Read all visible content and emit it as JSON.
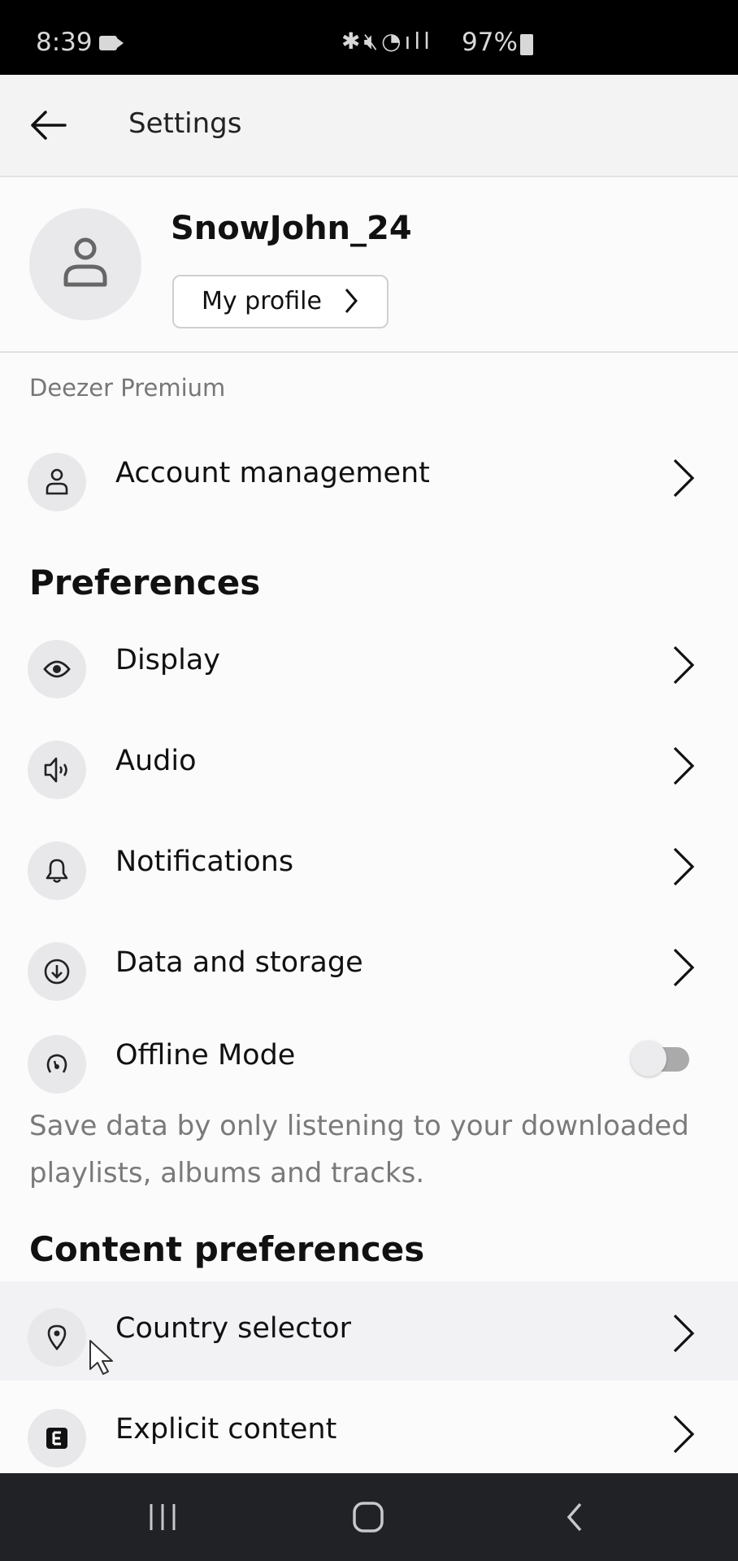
{
  "status_bar": {
    "time": "8:39",
    "status_icons": "bluetooth-icon mute-icon wifi-icon signal-icon",
    "battery": "97%"
  },
  "app_bar": {
    "back_icon": "arrow-left-icon",
    "title": "Settings"
  },
  "profile": {
    "username": "SnowJohn_24",
    "profile_button": "My profile"
  },
  "sections": {
    "subscription_caption": "Deezer Premium",
    "account_management": "Account management",
    "preferences_title": "Preferences",
    "preferences": [
      {
        "label": "Display",
        "icon": "eye-icon"
      },
      {
        "label": "Audio",
        "icon": "speaker-icon"
      },
      {
        "label": "Notifications",
        "icon": "bell-icon"
      },
      {
        "label": "Data and storage",
        "icon": "download-circle-icon"
      }
    ],
    "offline_mode": {
      "label": "Offline Mode",
      "enabled": false,
      "description": "Save data by only listening to your downloaded playlists, albums and tracks."
    },
    "content_preferences_title": "Content preferences",
    "content_preferences": [
      {
        "label": "Country selector",
        "icon": "location-pin-icon"
      },
      {
        "label": "Explicit content",
        "icon": "explicit-icon"
      }
    ]
  },
  "colors": {
    "background": "#fbfbfb",
    "icon_bg": "#e8e8eb",
    "highlight_row": "#f2f2f5",
    "nav_bar": "#202226"
  }
}
